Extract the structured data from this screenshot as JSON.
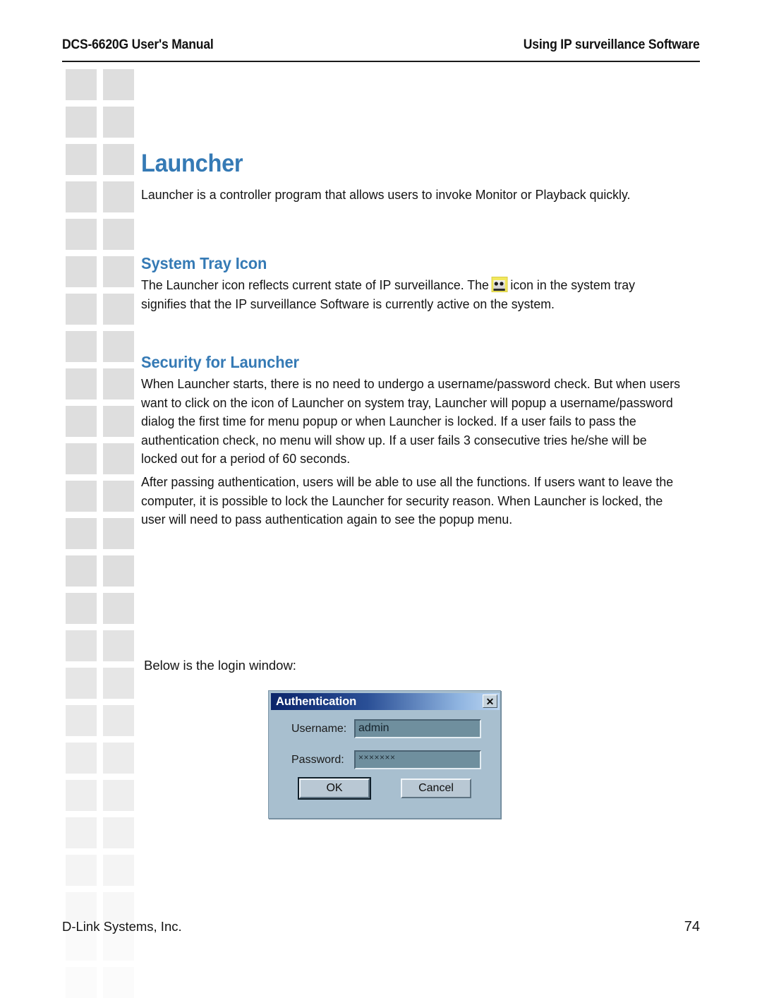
{
  "header": {
    "left": "DCS-6620G User's Manual",
    "right": "Using IP surveillance Software"
  },
  "page": {
    "title": "Launcher",
    "intro": "Launcher is a controller program that allows users to invoke Monitor or Playback quickly."
  },
  "sections": {
    "tray": {
      "heading": "System Tray Icon",
      "text_before_icon": "The Launcher icon reflects current state of IP surveillance. The",
      "icon_name": "ip-surveillance-tray-icon",
      "text_after_icon": "icon in the system tray signifies that the IP surveillance Software is currently active on the system."
    },
    "security": {
      "heading": "Security for Launcher",
      "paragraph1": "When Launcher starts, there is no need to undergo a username/password check. But when users want to click on the icon of Launcher on system tray, Launcher will popup a username/password dialog the first time for menu popup or when Launcher is locked. If a user fails to pass the authentication check, no menu will show up. If a user fails 3 consecutive tries he/she will be locked out for a period of 60 seconds.",
      "paragraph2": "After passing authentication, users will be able to use all the functions. If users want to leave the computer, it is possible to lock the Launcher for security reason. When Launcher is locked, the user will need to pass authentication again to see the popup menu."
    }
  },
  "login_caption": "Below is the login window:",
  "dialog": {
    "title": "Authentication",
    "close_label": "✕",
    "username_label": "Username:",
    "username_value": "admin",
    "username_placeholder": "",
    "password_label": "Password:",
    "password_value": "×××××××",
    "password_placeholder": "",
    "ok_label": "OK",
    "cancel_label": "Cancel"
  },
  "footer": {
    "left": "D-Link Systems, Inc.",
    "right": "74"
  },
  "colors": {
    "heading_blue": "#357ab5",
    "title_bar_dark": "#0a246a",
    "title_bar_light": "#bcd6f2",
    "dialog_face": "#a8bfcf",
    "field_fill": "#6f8f9e",
    "deco_square": "#dedede"
  }
}
